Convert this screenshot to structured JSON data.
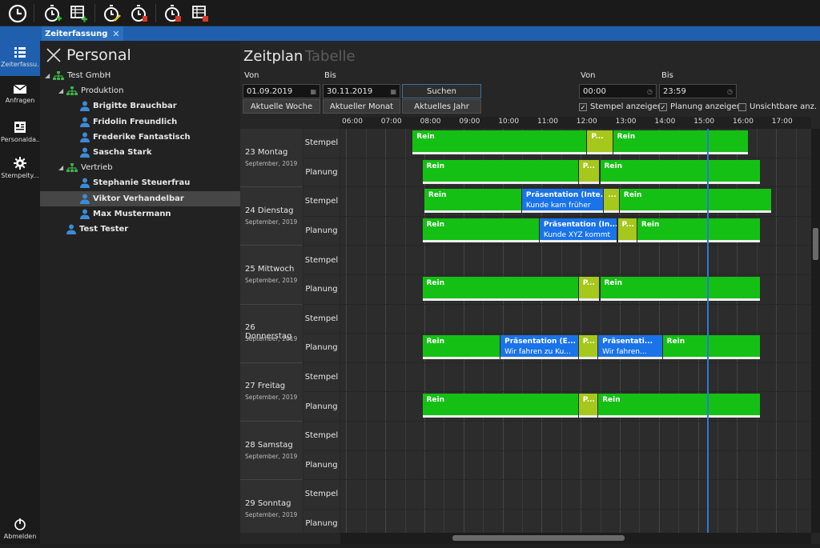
{
  "app": {
    "tab_label": "Zeiterfassung",
    "tab_close": "✕"
  },
  "leftnav": {
    "items": [
      {
        "label": "Zeiterfassu...",
        "icon": "list-icon"
      },
      {
        "label": "Anfragen",
        "icon": "mail-icon"
      },
      {
        "label": "Personalda...",
        "icon": "personnel-data-icon"
      },
      {
        "label": "Stempelty...",
        "icon": "gear-icon"
      }
    ],
    "logout_label": "Abmelden"
  },
  "personal": {
    "title": "Personal",
    "tree": [
      {
        "label": "Test GmbH",
        "level": 0,
        "type": "org",
        "bold": false
      },
      {
        "label": "Produktion",
        "level": 1,
        "type": "org",
        "bold": false
      },
      {
        "label": "Brigitte Brauchbar",
        "level": 2,
        "type": "person",
        "bold": true
      },
      {
        "label": "Fridolin Freundlich",
        "level": 2,
        "type": "person",
        "bold": true
      },
      {
        "label": "Frederike Fantastisch",
        "level": 2,
        "type": "person",
        "bold": true
      },
      {
        "label": "Sascha Stark",
        "level": 2,
        "type": "person",
        "bold": true
      },
      {
        "label": "Vertrieb",
        "level": 1,
        "type": "org",
        "bold": false
      },
      {
        "label": "Stephanie Steuerfrau",
        "level": 2,
        "type": "person",
        "bold": true
      },
      {
        "label": "Viktor Verhandelbar",
        "level": 2,
        "type": "person",
        "bold": true,
        "selected": true
      },
      {
        "label": "Max Mustermann",
        "level": 2,
        "type": "person",
        "bold": true
      },
      {
        "label": "Test Tester",
        "level": 1,
        "type": "person",
        "bold": true
      }
    ]
  },
  "zeitplan": {
    "title": "Zeitplan",
    "alt_tab": "Tabelle",
    "von_label": "Von",
    "bis_label": "Bis",
    "von_date": "01.09.2019",
    "bis_date": "30.11.2019",
    "search_button": "Suchen",
    "btn_week": "Aktuelle Woche",
    "btn_month": "Aktueller Monat",
    "btn_year": "Aktuelles Jahr",
    "time_von_label": "Von",
    "time_bis_label": "Bis",
    "time_von": "00:00",
    "time_bis": "23:59",
    "chk_stempel": "Stempel anzeigen",
    "chk_planung": "Planung anzeigen",
    "chk_unsichtbar": "Unsichtbare anz.",
    "hours": [
      "06:00",
      "07:00",
      "08:00",
      "09:00",
      "10:00",
      "11:00",
      "12:00",
      "13:00",
      "14:00",
      "15:00",
      "16:00",
      "17:00"
    ]
  },
  "days": [
    {
      "name": "23 Montag",
      "month": "September, 2019",
      "stempel": [
        {
          "from": 7.7,
          "to": 12.17,
          "color": "green",
          "title": "Rein"
        },
        {
          "from": 12.17,
          "to": 12.83,
          "color": "lime",
          "title": "P..."
        },
        {
          "from": 12.83,
          "to": 16.3,
          "color": "green",
          "title": "Rein"
        }
      ],
      "planung": [
        {
          "from": 7.95,
          "to": 11.95,
          "color": "green",
          "title": "Rein"
        },
        {
          "from": 11.95,
          "to": 12.5,
          "color": "lime",
          "title": "P..."
        },
        {
          "from": 12.5,
          "to": 16.6,
          "color": "green",
          "title": "Rein"
        }
      ]
    },
    {
      "name": "24 Dienstag",
      "month": "September, 2019",
      "stempel": [
        {
          "from": 8.0,
          "to": 10.5,
          "color": "green",
          "title": "Rein"
        },
        {
          "from": 10.5,
          "to": 12.6,
          "color": "blue",
          "title": "Präsentation (Inte...",
          "sub": "Kunde kam früher"
        },
        {
          "from": 12.6,
          "to": 13.0,
          "color": "lime",
          "title": "..."
        },
        {
          "from": 13.0,
          "to": 16.9,
          "color": "green",
          "title": "Rein"
        }
      ],
      "planung": [
        {
          "from": 7.95,
          "to": 10.95,
          "color": "green",
          "title": "Rein"
        },
        {
          "from": 10.95,
          "to": 12.95,
          "color": "blue",
          "title": "Präsentation (In...",
          "sub": "Kunde XYZ kommt"
        },
        {
          "from": 12.95,
          "to": 13.45,
          "color": "lime",
          "title": "P..."
        },
        {
          "from": 13.45,
          "to": 16.6,
          "color": "green",
          "title": "Rein"
        }
      ]
    },
    {
      "name": "25 Mittwoch",
      "month": "September, 2019",
      "stempel": [],
      "planung": [
        {
          "from": 7.95,
          "to": 11.95,
          "color": "green",
          "title": "Rein"
        },
        {
          "from": 11.95,
          "to": 12.5,
          "color": "lime",
          "title": "P..."
        },
        {
          "from": 12.5,
          "to": 16.6,
          "color": "green",
          "title": "Rein"
        }
      ]
    },
    {
      "name": "26 Donnerstag",
      "month": "September, 2019",
      "stempel": [],
      "planung": [
        {
          "from": 7.95,
          "to": 9.95,
          "color": "green",
          "title": "Rein"
        },
        {
          "from": 9.95,
          "to": 11.95,
          "color": "blue",
          "title": "Präsentation (E...",
          "sub": "Wir fahren zu Ku..."
        },
        {
          "from": 11.95,
          "to": 12.45,
          "color": "lime",
          "title": "P..."
        },
        {
          "from": 12.45,
          "to": 14.1,
          "color": "blue",
          "title": "Präsentati...",
          "sub": "Wir fahren..."
        },
        {
          "from": 14.1,
          "to": 16.6,
          "color": "green",
          "title": "Rein"
        }
      ]
    },
    {
      "name": "27 Freitag",
      "month": "September, 2019",
      "stempel": [],
      "planung": [
        {
          "from": 7.95,
          "to": 11.95,
          "color": "green",
          "title": "Rein"
        },
        {
          "from": 11.95,
          "to": 12.45,
          "color": "lime",
          "title": "P..."
        },
        {
          "from": 12.45,
          "to": 16.6,
          "color": "green",
          "title": "Rein"
        }
      ]
    },
    {
      "name": "28 Samstag",
      "month": "September, 2019",
      "stempel": [],
      "planung": []
    },
    {
      "name": "29 Sonntag",
      "month": "September, 2019",
      "stempel": [],
      "planung": []
    }
  ],
  "row_labels": {
    "stempel": "Stempel",
    "planung": "Planung"
  }
}
